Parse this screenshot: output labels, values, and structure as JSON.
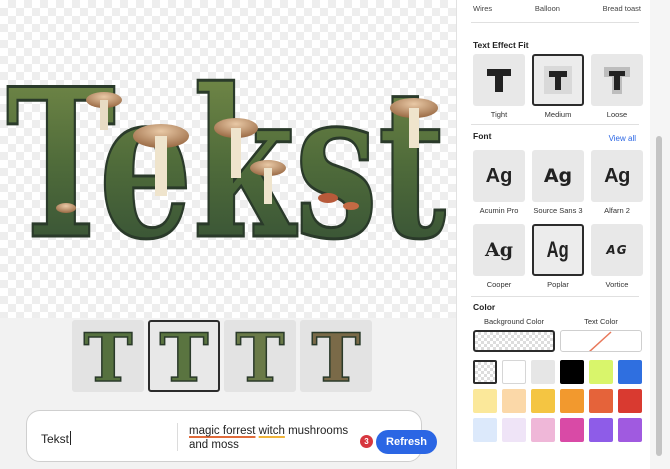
{
  "canvas": {
    "hero_text": "Tekst"
  },
  "thumbnails": [
    {
      "letter": "T",
      "selected": false
    },
    {
      "letter": "T",
      "selected": true
    },
    {
      "letter": "T",
      "selected": false
    },
    {
      "letter": "T",
      "selected": false
    }
  ],
  "prompt": {
    "text_value": "Tekst",
    "style_value_part1": "magic forrest",
    "style_value_part2": "witch",
    "style_value_part3": "mushrooms and moss",
    "badge_count": "3",
    "refresh_label": "Refresh"
  },
  "panel": {
    "top_labels": [
      "Wires",
      "Balloon",
      "Bread toast"
    ],
    "fit": {
      "title": "Text Effect Fit",
      "options": [
        {
          "label": "Tight",
          "selected": false
        },
        {
          "label": "Medium",
          "selected": true
        },
        {
          "label": "Loose",
          "selected": false
        }
      ]
    },
    "font": {
      "title": "Font",
      "view_all": "View all",
      "sample": "Ag",
      "options": [
        {
          "label": "Acumin Pro",
          "selected": false
        },
        {
          "label": "Source Sans 3",
          "selected": false
        },
        {
          "label": "Alfarn 2",
          "selected": false
        },
        {
          "label": "Cooper",
          "selected": false
        },
        {
          "label": "Poplar",
          "selected": true
        },
        {
          "label": "Vortice",
          "selected": false
        }
      ],
      "vortice_sample": "AG"
    },
    "color": {
      "title": "Color",
      "background_label": "Background Color",
      "text_label": "Text Color",
      "swatches": [
        "transparent",
        "#ffffff",
        "#e6e6e6",
        "#000000",
        "#d9f56b",
        "#2f6fe0",
        "#fbe89a",
        "#fbd8a8",
        "#f4c542",
        "#f2992e",
        "#e5633a",
        "#d93a30",
        "#dce9fb",
        "#efe4f7",
        "#efb7d8",
        "#d94aa6",
        "#8e5ce8",
        "#a05ae0"
      ]
    }
  },
  "colors": {
    "accent": "#2b66e4",
    "badge": "#d7373f",
    "selected_border": "#2c2c2c"
  }
}
